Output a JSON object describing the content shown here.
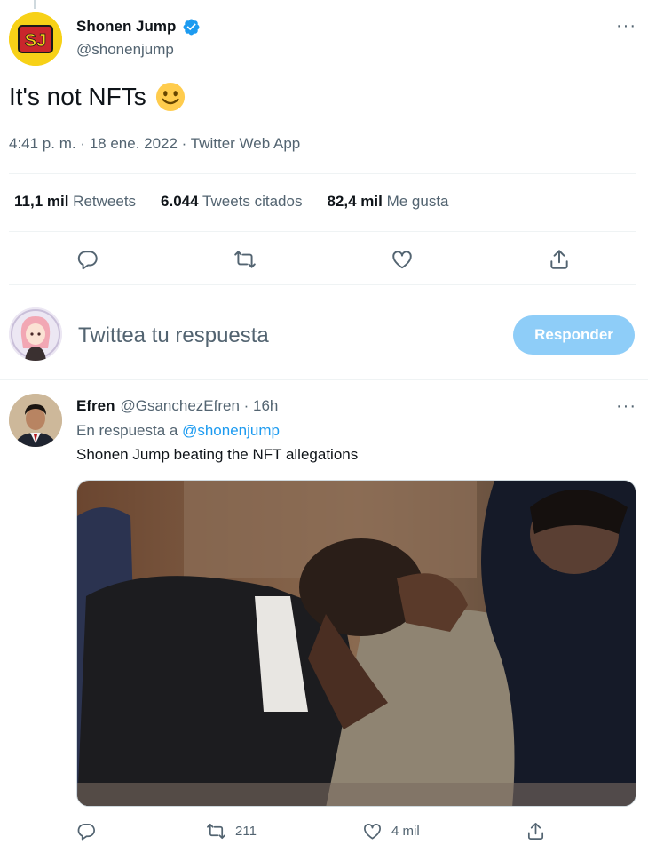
{
  "tweet": {
    "author_name": "Shonen Jump",
    "author_handle": "@shonenjump",
    "avatar_text": "SJ",
    "text": "It's not NFTs",
    "meta": "4:41 p. m. · 18 ene. 2022 · Twitter Web App",
    "stats": [
      {
        "value": "11,1 mil",
        "label": "Retweets"
      },
      {
        "value": "6.044",
        "label": "Tweets citados"
      },
      {
        "value": "82,4 mil",
        "label": "Me gusta"
      }
    ],
    "more_glyph": "···"
  },
  "compose": {
    "placeholder": "Twittea tu respuesta",
    "button_label": "Responder"
  },
  "reply": {
    "author_name": "Efren",
    "author_handle": "@GsanchezEfren · 16h",
    "reply_to_prefix": "En respuesta a",
    "reply_to_mention": "@shonenjump",
    "text": "Shonen Jump beating the NFT allegations",
    "retweets": "211",
    "likes": "4 mil",
    "more_glyph": "···"
  },
  "colors": {
    "accent": "#1d9bf0",
    "button_disabled": "#8ecdf8",
    "secondary_text": "#536471",
    "avatar_brand": "#f7d117"
  },
  "icons": [
    "verified-badge-icon",
    "smiley-emoji-icon",
    "reply-icon",
    "retweet-icon",
    "like-icon",
    "share-icon",
    "more-icon"
  ]
}
